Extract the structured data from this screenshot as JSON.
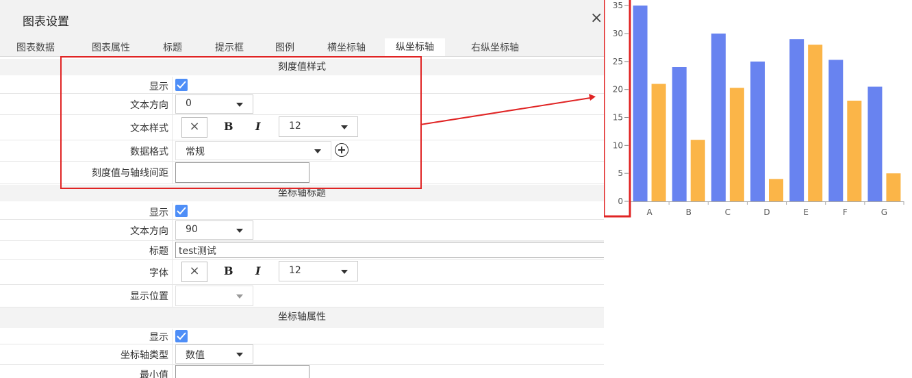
{
  "dialog": {
    "title": "图表设置",
    "close_icon": "×"
  },
  "tabs": [
    "图表数据",
    "图表属性",
    "标题",
    "提示框",
    "图例",
    "横坐标轴",
    "纵坐标轴",
    "右纵坐标轴"
  ],
  "active_tab": "纵坐标轴",
  "sections": {
    "tick_style": {
      "header": "刻度值样式",
      "show_label": "显示",
      "text_direction_label": "文本方向",
      "text_direction_value": "0",
      "text_style_label": "文本样式",
      "clear_glyph": "×",
      "bold_glyph": "B",
      "italic_glyph": "I",
      "font_size_value": "12",
      "data_format_label": "数据格式",
      "data_format_value": "常规",
      "gap_label": "刻度值与轴线间距",
      "gap_value": ""
    },
    "axis_title": {
      "header": "坐标轴标题",
      "show_label": "显示",
      "text_direction_label": "文本方向",
      "text_direction_value": "90",
      "title_label": "标题",
      "title_value": "test测试",
      "font_label": "字体",
      "clear_glyph": "×",
      "bold_glyph": "B",
      "italic_glyph": "I",
      "font_size_value": "12",
      "position_label": "显示位置",
      "position_value": ""
    },
    "axis_props": {
      "header": "坐标轴属性",
      "show_label": "显示",
      "axis_type_label": "坐标轴类型",
      "axis_type_value": "数值",
      "min_label": "最小值",
      "min_value": ""
    }
  },
  "colors": {
    "checkbox": "#4e8ef7",
    "highlight": "#e02424",
    "series1": "#6883f0",
    "series2": "#fbb548"
  },
  "chart_data": {
    "type": "bar",
    "categories": [
      "A",
      "B",
      "C",
      "D",
      "E",
      "F",
      "G"
    ],
    "series": [
      {
        "values": [
          35,
          24,
          30,
          25,
          29,
          25.3,
          20.5
        ]
      },
      {
        "values": [
          21,
          11,
          20.3,
          4,
          28,
          18,
          5
        ]
      }
    ],
    "yticks": [
      "0",
      "5",
      "10",
      "15",
      "20",
      "25",
      "30",
      "35"
    ],
    "ylim": [
      0,
      36
    ],
    "legend": "none",
    "grid": false
  }
}
